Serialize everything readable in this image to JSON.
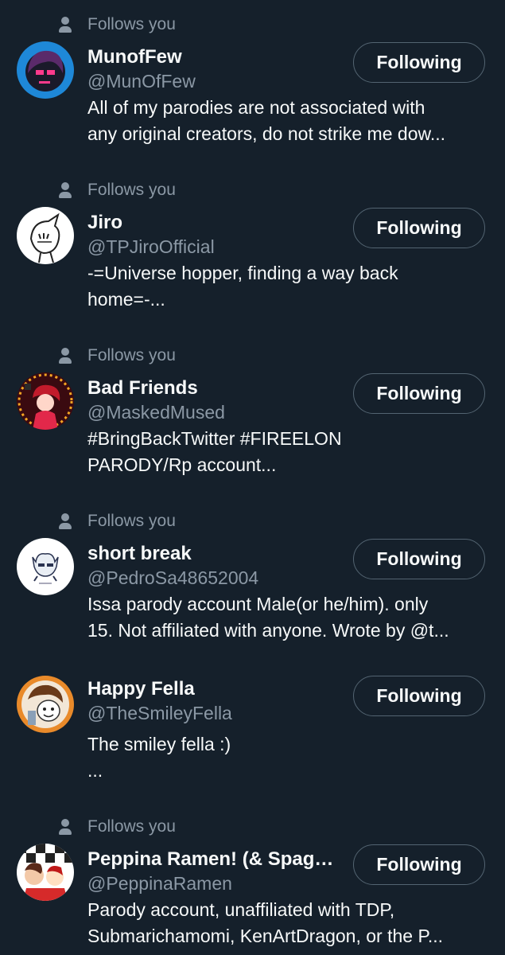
{
  "follows_you_label": "Follows you",
  "button_label": "Following",
  "users": [
    {
      "name": "MunofFew",
      "handle": "@MunOfFew",
      "bio": [
        "All of my parodies are not associated with",
        "any original creators, do not strike me dow..."
      ],
      "follows_you": true
    },
    {
      "name": "Jiro",
      "handle": "@TPJiroOfficial",
      "bio": [
        "-=Universe hopper, finding a way back",
        "home=-..."
      ],
      "follows_you": true
    },
    {
      "name": "Bad Friends",
      "handle": "@MaskedMused",
      "bio": [
        "#BringBackTwitter #FIREELON",
        "PARODY/Rp account..."
      ],
      "follows_you": true
    },
    {
      "name": "short break",
      "handle": "@PedroSa48652004",
      "bio": [
        "Issa parody account Male(or he/him). only",
        "15. Not affiliated with anyone. Wrote by @t..."
      ],
      "follows_you": true
    },
    {
      "name": "Happy Fella",
      "handle": "@TheSmileyFella",
      "bio": [
        "The smiley fella :)",
        "..."
      ],
      "follows_you": false
    },
    {
      "name": "Peppina Ramen! (& Spagh...",
      "handle": "@PeppinaRamen",
      "bio": [
        "Parody account, unaffiliated with TDP,",
        "Submarichamomi, KenArtDragon, or the P..."
      ],
      "follows_you": true
    }
  ],
  "colors": {
    "background": "#15202b",
    "text": "#f7f9f9",
    "secondary": "#8b98a5",
    "button_border": "#536471"
  }
}
